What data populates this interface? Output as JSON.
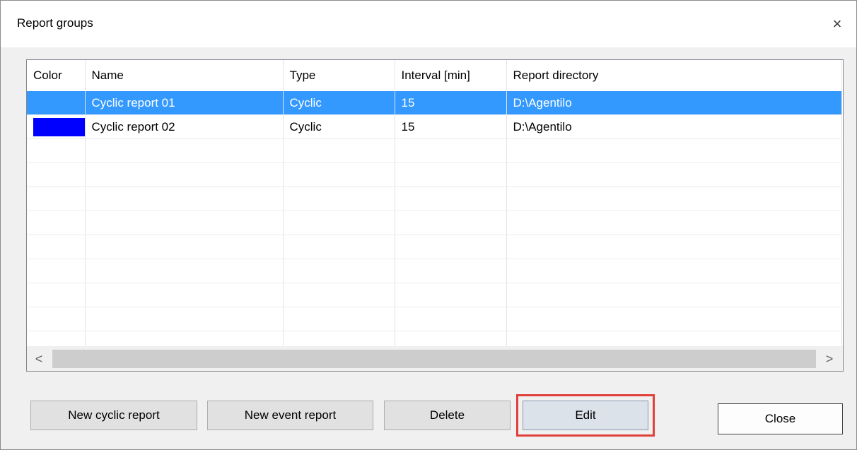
{
  "window": {
    "title": "Report groups",
    "close_glyph": "×"
  },
  "table": {
    "columns": [
      "Color",
      "Name",
      "Type",
      "Interval [min]",
      "Report directory"
    ],
    "rows": [
      {
        "color": "#3399ff",
        "name": "Cyclic report 01",
        "type": "Cyclic",
        "interval": "15",
        "directory": "D:\\Agentilo",
        "selected": true
      },
      {
        "color": "#0000ff",
        "name": "Cyclic report 02",
        "type": "Cyclic",
        "interval": "15",
        "directory": "D:\\Agentilo",
        "selected": false
      }
    ],
    "empty_rows": 9
  },
  "scrollbar": {
    "left_arrow": "<",
    "right_arrow": ">"
  },
  "buttons": {
    "new_cyclic": "New cyclic report",
    "new_event": "New event report",
    "delete": "Delete",
    "edit": "Edit",
    "close": "Close"
  },
  "colors": {
    "selection": "#3399ff",
    "highlight_border": "#e0403a"
  }
}
